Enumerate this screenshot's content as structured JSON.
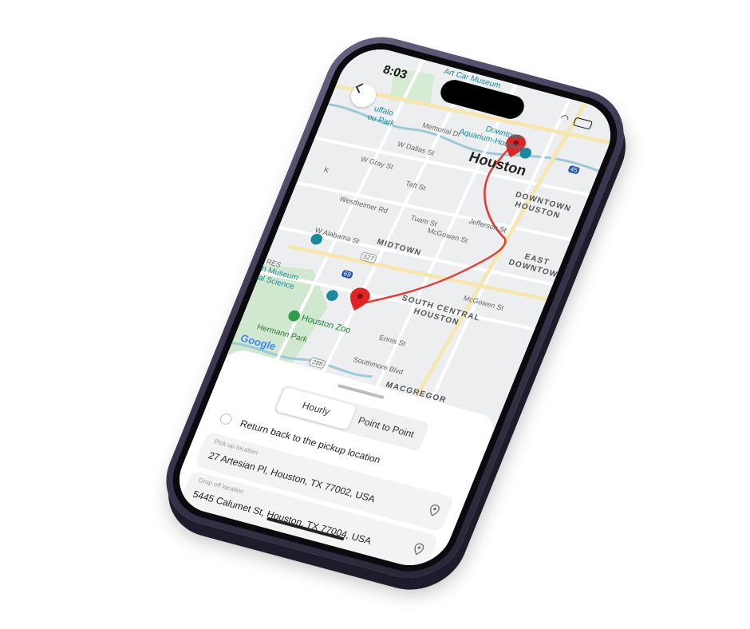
{
  "status": {
    "time": "8:03"
  },
  "map": {
    "city": "Houston",
    "districts": [
      "DOWNTOWN",
      "HOUSTON",
      "MIDTOWN",
      "SOUTH CENTRAL",
      "HOUSTON",
      "EAST",
      "DOWNTOWN",
      "MACGREGOR"
    ],
    "pois": {
      "art_car": "Art Car Museum",
      "aquarium_1": "Downtown",
      "aquarium_2": "Aquarium-Houston",
      "museum_1": "n Museum",
      "museum_2": "al Science",
      "zoo": "Houston Zoo",
      "park": "Hermann Park",
      "buffalo_1": "uffalo",
      "buffalo_2": "ou Park"
    },
    "streets": {
      "memorial": "Memorial Dr",
      "w_dallas": "W Dallas St",
      "w_gray": "W Gray St",
      "taft": "Taft St",
      "westheimer": "Westheimer Rd",
      "tuam": "Tuam St",
      "mcgowen": "McGowen St",
      "jefferson": "Jefferson St",
      "w_alabama": "W Alabama St",
      "mcgowen2": "McGowen St",
      "ennis": "Ennis St",
      "southmore": "Southmore Blvd",
      "res": "RES",
      "k": "K"
    },
    "shields": {
      "h527": "527",
      "i69": "69",
      "h288": "288",
      "i10": "10",
      "i45": "45"
    },
    "attribution": "Google"
  },
  "sheet": {
    "tabs": {
      "hourly": "Hourly",
      "point_to_point": "Point to Point"
    },
    "return_label": "Return back to the pickup location",
    "pickup": {
      "label": "Pick up location",
      "value": "27 Artesian Pl, Houston, TX 77002, USA"
    },
    "dropoff": {
      "label": "Drop off location",
      "value": "5445 Calumet St, Houston, TX 77004, USA"
    }
  },
  "colors": {
    "route": "#e53935",
    "pin": "#e02424",
    "frame": "#3d3852"
  }
}
